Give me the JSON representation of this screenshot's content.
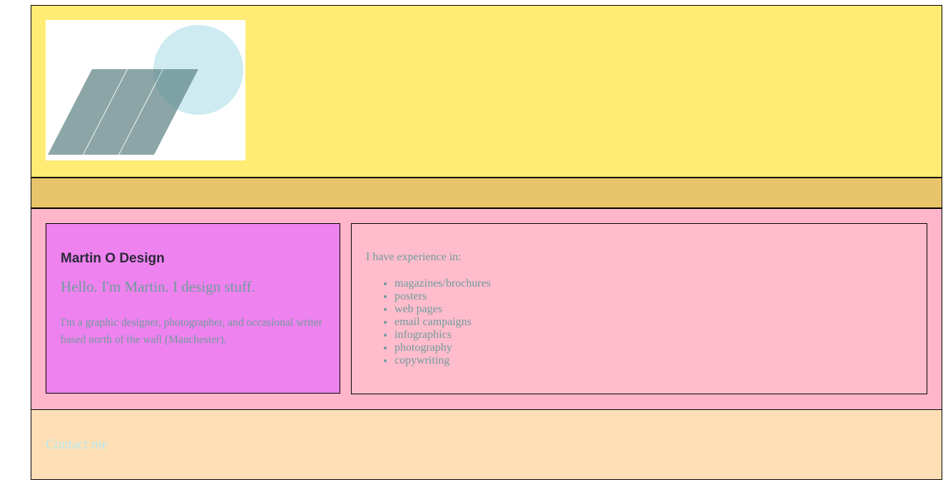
{
  "header": {
    "logo": {
      "icon": "stripes-and-circle-logo",
      "colors": {
        "circle": "#cdebf1",
        "stripes": "#7c9b9c"
      }
    }
  },
  "main": {
    "intro": {
      "site_title": "Martin O Design",
      "hello": "Hello. I'm Martin. I design stuff.",
      "bio": "I'm a graphic designer, photographer, and occasional writer based north of the wall (Manchester)."
    },
    "experience": {
      "heading": "I have experience in:",
      "items": [
        "magazines/brochures",
        "posters",
        "web pages",
        "email campaigns",
        "infographics",
        "photography",
        "copywriting"
      ]
    }
  },
  "footer": {
    "contact_label": "Contact me"
  },
  "colors": {
    "header_bg": "#ffec74",
    "nav_bg": "#e8c56a",
    "main_bg": "#ffb6cb",
    "intro_bg": "#ee82ee",
    "experience_bg": "#ffbccc",
    "footer_bg": "#ffe0b6",
    "text_teal": "#6e9c9c",
    "link_light_blue": "#b7e8ef"
  }
}
